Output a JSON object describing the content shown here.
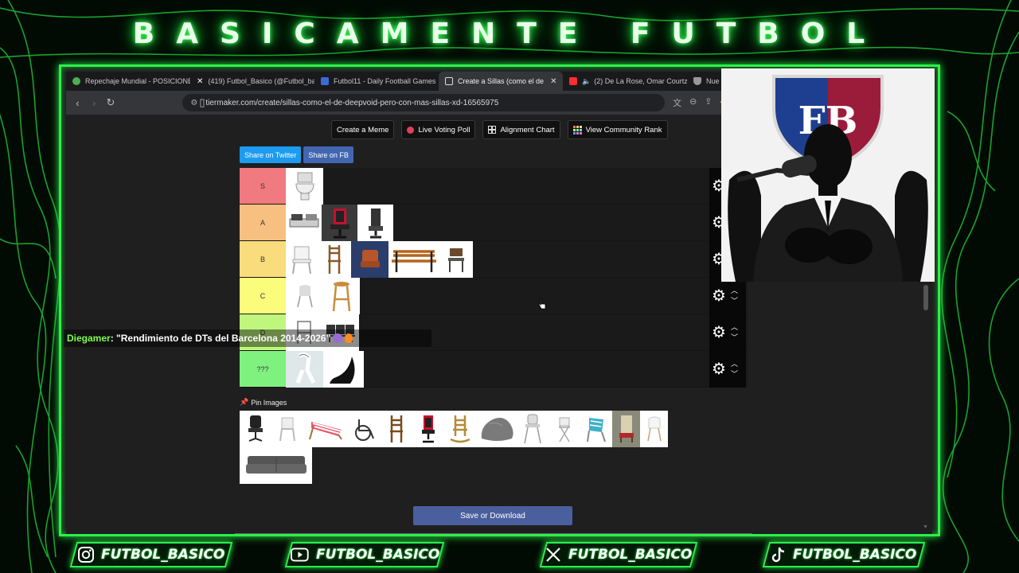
{
  "banner": "BASICAMENTE FUTBOL",
  "browser": {
    "tabs": [
      {
        "label": "Repechaje Mundial - POSICIONE",
        "icon": "globe-icon",
        "color": "#4caf50"
      },
      {
        "label": "(419) Futbol_Basico (@Futbol_ba",
        "icon": "x-logo-icon",
        "color": "#ffffff"
      },
      {
        "label": "Futbol11 - Daily Football Games",
        "icon": "futbol11-icon",
        "color": "#3b6bd6"
      },
      {
        "label": "Create a Sillas (como el de",
        "icon": "tiermaker-icon",
        "color": "#ffffff",
        "active": true
      },
      {
        "label": "(2) De La Rose, Omar Courtz",
        "icon": "youtube-icon",
        "color": "#ff2d2d"
      },
      {
        "label": "Nue",
        "icon": "shield-icon",
        "color": "#bbbbbb"
      }
    ],
    "url": "tiermaker.com/create/sillas-como-el-de-deepvoid-pero-con-mas-sillas-xd-16565975"
  },
  "toolbar": {
    "create_meme": "Create a Meme",
    "live_voting": "Live Voting Poll",
    "alignment": "Alignment Chart",
    "community": "View Community Rank"
  },
  "share": {
    "twitter": "Share on Twitter",
    "fb": "Share on FB"
  },
  "tiers": [
    {
      "label": "S",
      "color": "#f07a7f"
    },
    {
      "label": "A",
      "color": "#f8c080"
    },
    {
      "label": "B",
      "color": "#f9dd7c"
    },
    {
      "label": "C",
      "color": "#fbfb7c"
    },
    {
      "label": "D",
      "color": "#bff77e"
    },
    {
      "label": "???",
      "color": "#7ef17e"
    }
  ],
  "pin_label": "Pin Images",
  "save_label": "Save or Download",
  "chat": {
    "user": "Diegamer",
    "message": ": \"Rendimiento de DTs del Barcelona 2014-2026\""
  },
  "socials": [
    {
      "icon": "instagram-icon",
      "handle": "FUTBOL_BASICO"
    },
    {
      "icon": "youtube-icon",
      "handle": "FUTBOL_BASICO"
    },
    {
      "icon": "x-logo-icon",
      "handle": "FUTBOL_BASICO"
    },
    {
      "icon": "tiktok-icon",
      "handle": "FUTBOL_BASICO"
    }
  ],
  "cam_logo": "FB"
}
